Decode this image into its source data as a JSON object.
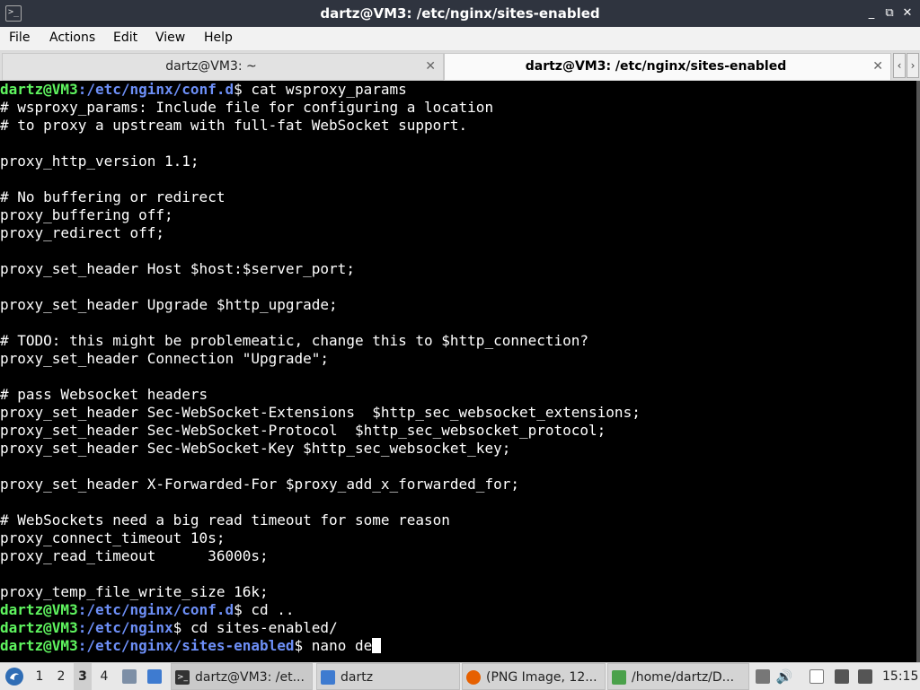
{
  "window": {
    "title": "dartz@VM3: /etc/nginx/sites-enabled",
    "app_icon": "terminal-icon",
    "controls": {
      "minimize": "_",
      "restore": "⧉",
      "close": "✕"
    }
  },
  "menubar": {
    "items": [
      "File",
      "Actions",
      "Edit",
      "View",
      "Help"
    ]
  },
  "tabs": [
    {
      "label": "dartz@VM3: ~",
      "active": false
    },
    {
      "label": "dartz@VM3: /etc/nginx/sites-enabled",
      "active": true
    }
  ],
  "tab_nav": {
    "prev": "‹",
    "next": "›"
  },
  "terminal": {
    "colors": {
      "user": "#5ff55f",
      "path": "#6d8ff7",
      "text": "#ffffff",
      "background": "#000000"
    },
    "lines": [
      {
        "user": "dartz@VM3",
        "path": ":/etc/nginx/conf.d",
        "cmd": "$ cat wsproxy_params"
      },
      {
        "text": "# wsproxy_params: Include file for configuring a location"
      },
      {
        "text": "# to proxy a upstream with full-fat WebSocket support."
      },
      {
        "text": ""
      },
      {
        "text": "proxy_http_version 1.1;"
      },
      {
        "text": ""
      },
      {
        "text": "# No buffering or redirect"
      },
      {
        "text": "proxy_buffering off;"
      },
      {
        "text": "proxy_redirect off;"
      },
      {
        "text": ""
      },
      {
        "text": "proxy_set_header Host $host:$server_port;"
      },
      {
        "text": ""
      },
      {
        "text": "proxy_set_header Upgrade $http_upgrade;"
      },
      {
        "text": ""
      },
      {
        "text": "# TODO: this might be problemeatic, change this to $http_connection?"
      },
      {
        "text": "proxy_set_header Connection \"Upgrade\";"
      },
      {
        "text": ""
      },
      {
        "text": "# pass Websocket headers"
      },
      {
        "text": "proxy_set_header Sec-WebSocket-Extensions  $http_sec_websocket_extensions;"
      },
      {
        "text": "proxy_set_header Sec-WebSocket-Protocol  $http_sec_websocket_protocol;"
      },
      {
        "text": "proxy_set_header Sec-WebSocket-Key $http_sec_websocket_key;"
      },
      {
        "text": ""
      },
      {
        "text": "proxy_set_header X-Forwarded-For $proxy_add_x_forwarded_for;"
      },
      {
        "text": ""
      },
      {
        "text": "# WebSockets need a big read timeout for some reason"
      },
      {
        "text": "proxy_connect_timeout 10s;"
      },
      {
        "text": "proxy_read_timeout      36000s;"
      },
      {
        "text": ""
      },
      {
        "text": "proxy_temp_file_write_size 16k;"
      },
      {
        "user": "dartz@VM3",
        "path": ":/etc/nginx/conf.d",
        "cmd": "$ cd .."
      },
      {
        "user": "dartz@VM3",
        "path": ":/etc/nginx",
        "cmd": "$ cd sites-enabled/"
      },
      {
        "user": "dartz@VM3",
        "path": ":/etc/nginx/sites-enabled",
        "cmd": "$ nano de",
        "cursor": true
      }
    ]
  },
  "taskbar": {
    "start_icon": "start-menu-icon",
    "workspaces": [
      {
        "label": "1",
        "active": false
      },
      {
        "label": "2",
        "active": false
      },
      {
        "label": "3",
        "active": true
      },
      {
        "label": "4",
        "active": false
      }
    ],
    "tasks": [
      {
        "label": "dartz@VM3: /et...",
        "icon": "terminal-icon",
        "active": true
      },
      {
        "label": "dartz",
        "icon": "folder-icon",
        "active": false
      },
      {
        "label": "(PNG Image, 12...",
        "icon": "firefox-icon",
        "active": false
      },
      {
        "label": "/home/dartz/D...",
        "icon": "text-editor-icon",
        "active": false
      }
    ],
    "clock": "15:15"
  }
}
